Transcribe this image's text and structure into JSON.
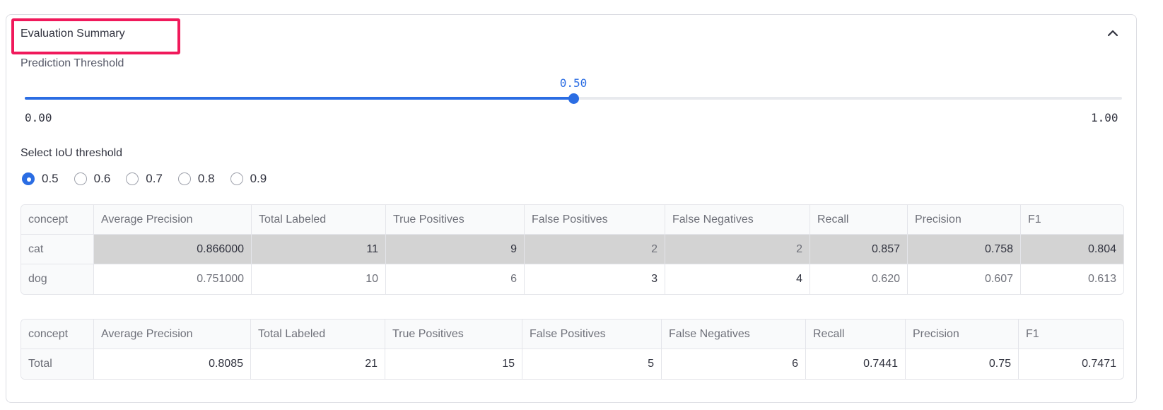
{
  "expander": {
    "title": "Evaluation Summary"
  },
  "slider": {
    "label": "Prediction Threshold",
    "value": 0.5,
    "value_text": "0.50",
    "min_text": "0.00",
    "max_text": "1.00"
  },
  "iou": {
    "label": "Select IoU threshold",
    "options": [
      "0.5",
      "0.6",
      "0.7",
      "0.8",
      "0.9"
    ],
    "selected": "0.5"
  },
  "concept_table": {
    "columns": [
      "concept",
      "Average Precision",
      "Total Labeled",
      "True Positives",
      "False Positives",
      "False Negatives",
      "Recall",
      "Precision",
      "F1"
    ],
    "rows": [
      [
        "cat",
        "0.866000",
        "11",
        "9",
        "2",
        "2",
        "0.857",
        "0.758",
        "0.804"
      ],
      [
        "dog",
        "0.751000",
        "10",
        "6",
        "3",
        "4",
        "0.620",
        "0.607",
        "0.613"
      ]
    ]
  },
  "total_table": {
    "columns": [
      "concept",
      "Average Precision",
      "Total Labeled",
      "True Positives",
      "False Positives",
      "False Negatives",
      "Recall",
      "Precision",
      "F1"
    ],
    "rows": [
      [
        "Total",
        "0.8085",
        "21",
        "15",
        "5",
        "6",
        "0.7441",
        "0.75",
        "0.7471"
      ]
    ]
  },
  "colors": {
    "accent": "#2b6de3",
    "highlight_box": "#f0195b",
    "highlight_row": "#d3d3d3"
  }
}
